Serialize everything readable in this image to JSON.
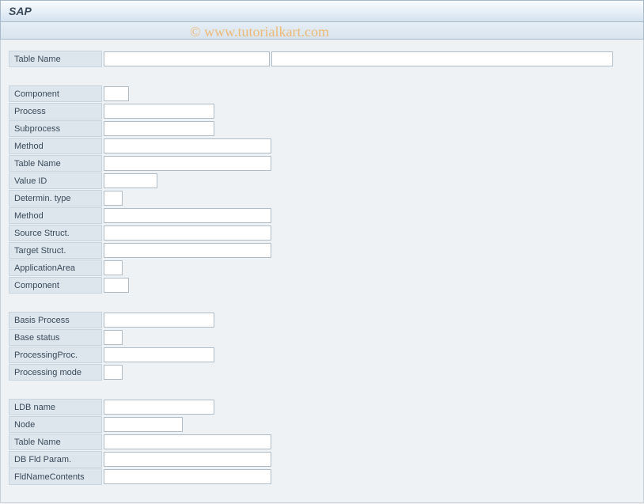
{
  "title": "SAP",
  "watermark": "© www.tutorialkart.com",
  "topSection": {
    "tableName": {
      "label": "Table Name",
      "value1": "",
      "value2": ""
    }
  },
  "section1": {
    "component": {
      "label": "Component",
      "value": ""
    },
    "process": {
      "label": "Process",
      "value": ""
    },
    "subprocess": {
      "label": "Subprocess",
      "value": ""
    },
    "method": {
      "label": "Method",
      "value": ""
    },
    "tableName": {
      "label": "Table Name",
      "value": ""
    },
    "valueId": {
      "label": "Value ID",
      "value": ""
    },
    "determinType": {
      "label": "Determin. type",
      "value": ""
    },
    "method2": {
      "label": "Method",
      "value": ""
    },
    "sourceStruct": {
      "label": "Source Struct.",
      "value": ""
    },
    "targetStruct": {
      "label": "Target Struct.",
      "value": ""
    },
    "applicationArea": {
      "label": "ApplicationArea",
      "value": ""
    },
    "component2": {
      "label": "Component",
      "value": ""
    }
  },
  "section2": {
    "basisProcess": {
      "label": "Basis Process",
      "value": ""
    },
    "baseStatus": {
      "label": "Base status",
      "value": ""
    },
    "processingProc": {
      "label": "ProcessingProc.",
      "value": ""
    },
    "processingMode": {
      "label": "Processing mode",
      "value": ""
    }
  },
  "section3": {
    "ldbName": {
      "label": "LDB name",
      "value": ""
    },
    "node": {
      "label": "Node",
      "value": ""
    },
    "tableName": {
      "label": "Table Name",
      "value": ""
    },
    "dbFldParam": {
      "label": "DB Fld Param.",
      "value": ""
    },
    "fldNameContents": {
      "label": "FldNameContents",
      "value": ""
    }
  }
}
